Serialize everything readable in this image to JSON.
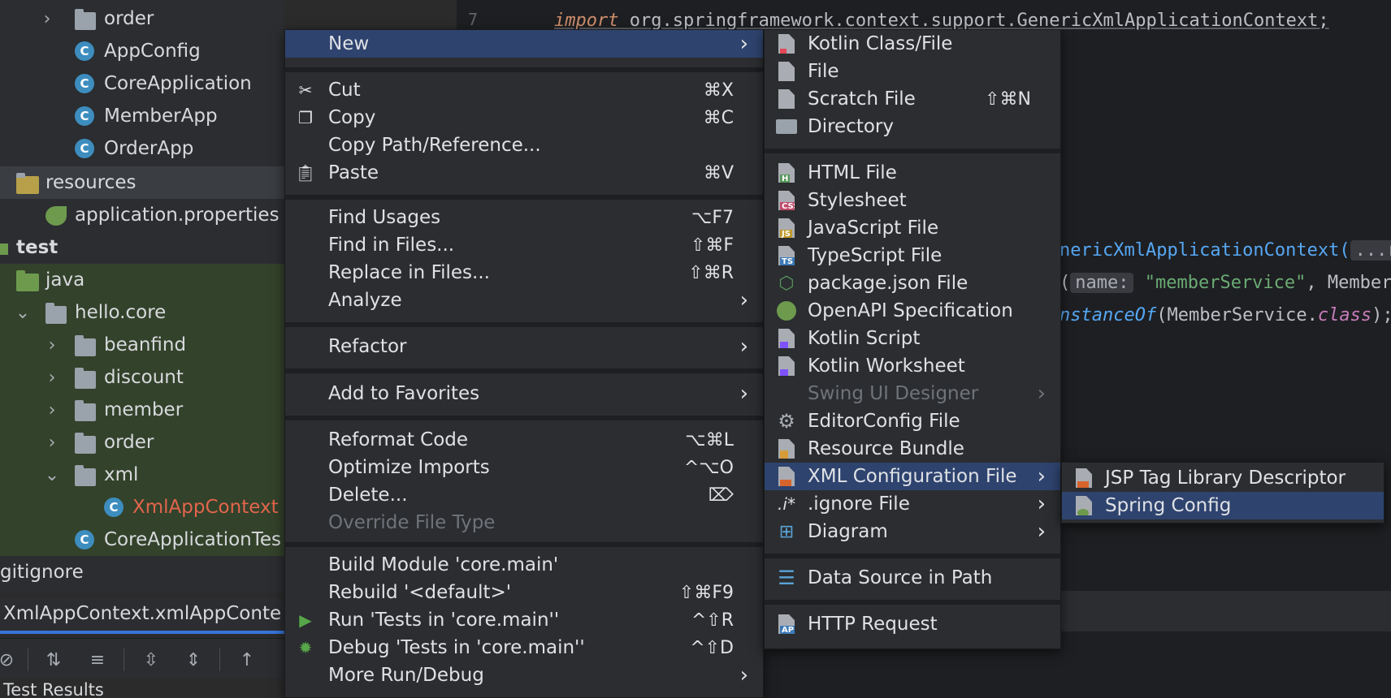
{
  "tree": {
    "items": [
      {
        "label": "order"
      },
      {
        "label": "AppConfig"
      },
      {
        "label": "CoreApplication"
      },
      {
        "label": "MemberApp"
      },
      {
        "label": "OrderApp"
      },
      {
        "label": "resources"
      },
      {
        "label": "application.properties"
      },
      {
        "label": "test"
      },
      {
        "label": "java"
      },
      {
        "label": "hello.core"
      },
      {
        "label": "beanfind"
      },
      {
        "label": "discount"
      },
      {
        "label": "member"
      },
      {
        "label": "order"
      },
      {
        "label": "xml"
      },
      {
        "label": "XmlAppContext"
      },
      {
        "label": "CoreApplicationTes"
      },
      {
        "label": "gitignore"
      }
    ]
  },
  "bottom": {
    "tab_label": "XmlAppContext.xmlAppConte",
    "test_results": "Test Results"
  },
  "editor": {
    "line_number": "7",
    "import_keyword": "import",
    "import_path": "org.springframework.context.support.GenericXmlApplicationContext;",
    "line2_prefix": "nericXmlApplicationContext(",
    "line2_hint": "...re",
    "line3_prefix": "(",
    "line3_hint": "name:",
    "line3_string": "\"memberService\"",
    "line3_suffix": ", Member",
    "line4_fn": "nstanceOf",
    "line4_arg": "(MemberService.",
    "line4_kw": "class",
    "line4_end": ");"
  },
  "context_menu": {
    "items": [
      {
        "label": "New",
        "shortcut": "",
        "submenu": true
      },
      {
        "label": "Cut",
        "shortcut": "⌘X",
        "icon": "scissors-icon"
      },
      {
        "label": "Copy",
        "shortcut": "⌘C",
        "icon": "copy-icon"
      },
      {
        "label": "Copy Path/Reference...",
        "shortcut": ""
      },
      {
        "label": "Paste",
        "shortcut": "⌘V",
        "icon": "clipboard-icon"
      },
      {
        "label": "Find Usages",
        "shortcut": "⌥F7"
      },
      {
        "label": "Find in Files...",
        "shortcut": "⇧⌘F"
      },
      {
        "label": "Replace in Files...",
        "shortcut": "⇧⌘R"
      },
      {
        "label": "Analyze",
        "shortcut": "",
        "submenu": true
      },
      {
        "label": "Refactor",
        "shortcut": "",
        "submenu": true
      },
      {
        "label": "Add to Favorites",
        "shortcut": "",
        "submenu": true
      },
      {
        "label": "Reformat Code",
        "shortcut": "⌥⌘L"
      },
      {
        "label": "Optimize Imports",
        "shortcut": "^⌥O"
      },
      {
        "label": "Delete...",
        "shortcut": "⌦"
      },
      {
        "label": "Override File Type",
        "shortcut": "",
        "disabled": true
      },
      {
        "label": "Build Module 'core.main'",
        "shortcut": ""
      },
      {
        "label": "Rebuild '<default>'",
        "shortcut": "⇧⌘F9"
      },
      {
        "label": "Run 'Tests in 'core.main''",
        "shortcut": "^⇧R",
        "icon": "run-icon"
      },
      {
        "label": "Debug 'Tests in 'core.main''",
        "shortcut": "^⇧D",
        "icon": "debug-icon"
      },
      {
        "label": "More Run/Debug",
        "shortcut": "",
        "submenu": true
      }
    ]
  },
  "new_menu": {
    "items": [
      {
        "label": "Kotlin Class/File",
        "shortcut": ""
      },
      {
        "label": "File",
        "shortcut": ""
      },
      {
        "label": "Scratch File",
        "shortcut": "⇧⌘N"
      },
      {
        "label": "Directory",
        "shortcut": ""
      },
      {
        "label": "HTML File",
        "badge": "H"
      },
      {
        "label": "Stylesheet",
        "badge": "CSS"
      },
      {
        "label": "JavaScript File",
        "badge": "JS"
      },
      {
        "label": "TypeScript File",
        "badge": "TS"
      },
      {
        "label": "package.json File"
      },
      {
        "label": "OpenAPI Specification"
      },
      {
        "label": "Kotlin Script"
      },
      {
        "label": "Kotlin Worksheet"
      },
      {
        "label": "Swing UI Designer",
        "disabled": true,
        "submenu": true
      },
      {
        "label": "EditorConfig File"
      },
      {
        "label": "Resource Bundle"
      },
      {
        "label": "XML Configuration File",
        "submenu": true
      },
      {
        "label": ".ignore File",
        "icon_text": ".i*",
        "submenu": true
      },
      {
        "label": "Diagram",
        "submenu": true
      },
      {
        "label": "Data Source in Path"
      },
      {
        "label": "HTTP Request",
        "badge": "API"
      }
    ]
  },
  "xml_menu": {
    "items": [
      {
        "label": "JSP Tag Library Descriptor"
      },
      {
        "label": "Spring Config"
      }
    ]
  },
  "colors": {
    "menu_bg": "#2b2d30",
    "highlight": "#2e436e",
    "accent_blue": "#3874d8",
    "test_green": "#33422b"
  }
}
